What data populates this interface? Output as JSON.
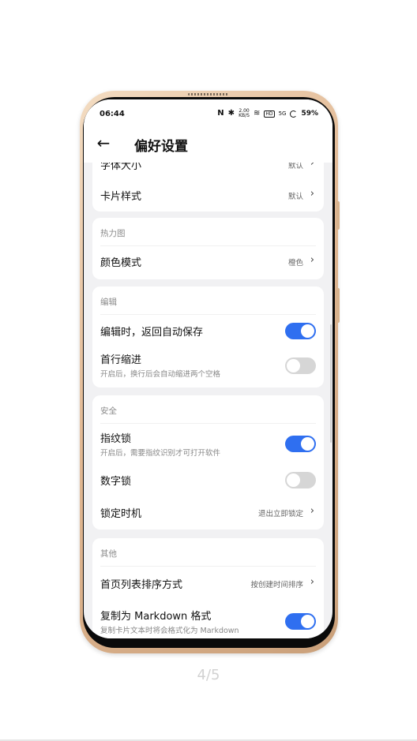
{
  "status_bar": {
    "time": "06:44",
    "nfc": "N",
    "bluetooth": "✱",
    "speed": "2.00 KB/S",
    "wifi": "≋",
    "hd": "HD",
    "signal": "5G",
    "battery": "59%"
  },
  "appbar": {
    "back_icon": "←",
    "title": "偏好设置"
  },
  "sections": {
    "display": {
      "font_size_label": "字体大小",
      "font_size_value": "默认",
      "card_style_label": "卡片样式",
      "card_style_value": "默认"
    },
    "heatmap": {
      "header": "热力图",
      "color_mode_label": "颜色模式",
      "color_mode_value": "橙色"
    },
    "edit": {
      "header": "编辑",
      "autosave_label": "编辑时，返回自动保存",
      "autosave_on": true,
      "indent_label": "首行缩进",
      "indent_sub": "开启后，换行后会自动缩进两个空格",
      "indent_on": false
    },
    "security": {
      "header": "安全",
      "fingerprint_label": "指纹锁",
      "fingerprint_sub": "开启后，需要指纹识别才可打开软件",
      "fingerprint_on": true,
      "pin_label": "数字锁",
      "pin_on": false,
      "lock_timing_label": "锁定时机",
      "lock_timing_value": "退出立即锁定"
    },
    "other": {
      "header": "其他",
      "sort_label": "首页列表排序方式",
      "sort_value": "按创建时间排序",
      "markdown_label": "复制为 Markdown 格式",
      "markdown_sub": "复制卡片文本时将会格式化为 Markdown",
      "markdown_on": true
    }
  },
  "chevron": "›",
  "pager": "4/5",
  "colors": {
    "accent": "#2f6ff0",
    "toggle_off": "#d6d6d6",
    "frame": "#e0b792"
  }
}
